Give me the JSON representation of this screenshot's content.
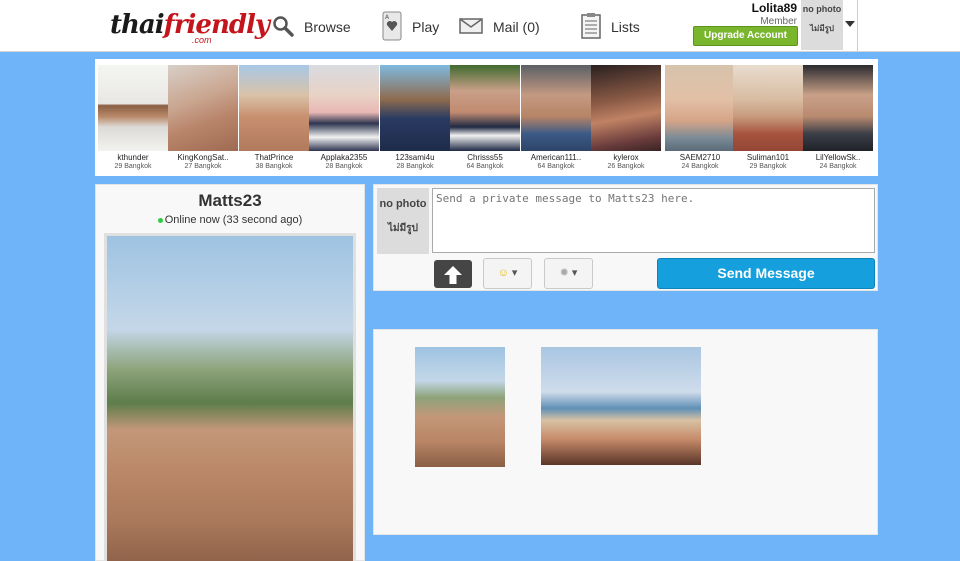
{
  "header": {
    "logo_thai": "thai",
    "logo_friendly": "friendly",
    "logo_com": ".com",
    "nav": [
      {
        "label": "Browse",
        "icon": "search-icon"
      },
      {
        "label": "Play",
        "icon": "card-icon"
      },
      {
        "label": "Mail (0)",
        "icon": "envelope-icon"
      },
      {
        "label": "Lists",
        "icon": "list-icon"
      }
    ],
    "username": "Lolita89",
    "role": "Member",
    "upgrade_label": "Upgrade Account",
    "avatar_no_photo": "no photo",
    "avatar_thai": "ไม่มีรูป"
  },
  "members": [
    {
      "name": "kthunder",
      "info": "29 Bangkok"
    },
    {
      "name": "KingKongSat..",
      "info": "27 Bangkok"
    },
    {
      "name": "ThatPrince",
      "info": "38 Bangkok"
    },
    {
      "name": "Applaka2355",
      "info": "28 Bangkok"
    },
    {
      "name": "123sami4u",
      "info": "28 Bangkok"
    },
    {
      "name": "Chrisss55",
      "info": "64 Bangkok"
    },
    {
      "name": "American111..",
      "info": "64 Bangkok"
    },
    {
      "name": "kylerox",
      "info": "26 Bangkok"
    },
    {
      "name": "SAEM2710",
      "info": "24 Bangkok"
    },
    {
      "name": "Suliman101",
      "info": "29 Bangkok"
    },
    {
      "name": "LilYellowSk..",
      "info": "24 Bangkok"
    }
  ],
  "profile": {
    "name": "Matts23",
    "status": "Online now (33 second ago)"
  },
  "message": {
    "avatar_no_photo": "no photo",
    "avatar_thai": "ไม่มีรูป",
    "placeholder": "Send a private message to Matts23 here.",
    "send_label": "Send Message"
  },
  "colors": {
    "page_bg": "#6fb3f8",
    "send_button": "#159fdc",
    "upgrade_button": "#7ab62d",
    "online_dot": "#2ecc40"
  }
}
